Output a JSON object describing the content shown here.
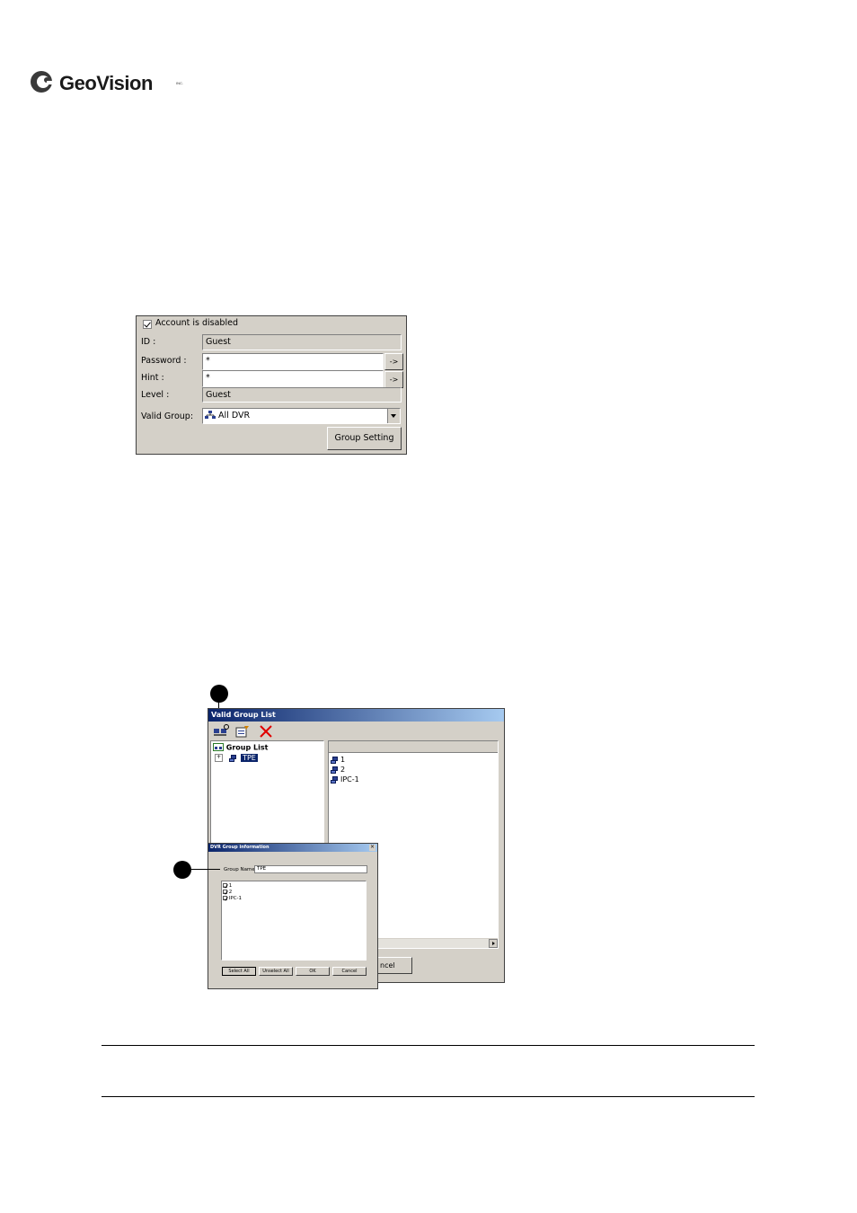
{
  "brand": {
    "name": "GeoVision",
    "trademark": "INC."
  },
  "account_panel": {
    "disabled_label": "Account is disabled",
    "disabled_checked": true,
    "id_label": "ID :",
    "id_value": "Guest",
    "password_label": "Password :",
    "password_value": "*",
    "hint_label": "Hint :",
    "hint_value": "*",
    "arrow_button": "->",
    "level_label": "Level :",
    "level_value": "Guest",
    "valid_group_label": "Valid Group:",
    "valid_group_value": "All DVR",
    "group_setting_button": "Group Setting"
  },
  "valid_group_window": {
    "title": "Valid Group List",
    "tree_root": "Group List",
    "tree_items": [
      "TPE"
    ],
    "device_list": [
      "1",
      "2",
      "IPC-1"
    ],
    "cancel_partial": "ncel"
  },
  "dvr_group_dialog": {
    "title": "DVR Group information",
    "group_name_label": "Group Name",
    "group_name_value": "TPE",
    "devices": [
      "1",
      "2",
      "IPC-1"
    ],
    "buttons": {
      "select_all": "Select All",
      "unselect_all": "Unselect All",
      "ok": "OK",
      "cancel": "Cancel"
    }
  }
}
